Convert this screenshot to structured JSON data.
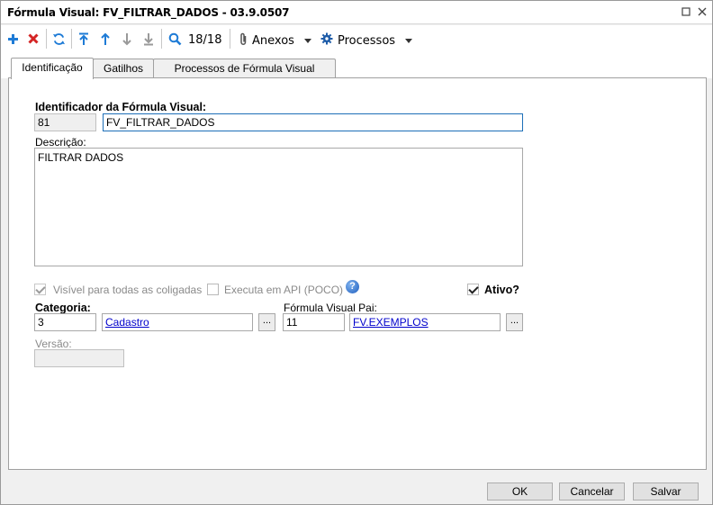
{
  "window": {
    "title": "Fórmula Visual: FV_FILTRAR_DADOS - 03.9.0507"
  },
  "toolbar": {
    "counter": "18/18",
    "anexos_label": "Anexos",
    "processos_label": "Processos"
  },
  "tabs": [
    {
      "label": "Identificação"
    },
    {
      "label": "Gatilhos"
    },
    {
      "label": "Processos de Fórmula Visual"
    }
  ],
  "form": {
    "identificador_label": "Identificador da Fórmula Visual:",
    "id_value": "81",
    "name_value": "FV_FILTRAR_DADOS",
    "descricao_label": "Descrição:",
    "descricao_value": "FILTRAR DADOS",
    "visivel_label": "Visível para todas as coligadas",
    "executa_label": "Executa em API (POCO)",
    "ativo_label": "Ativo?",
    "categoria_label": "Categoria:",
    "categoria_code": "3",
    "categoria_name": "Cadastro",
    "formula_pai_label": "Fórmula Visual Pai:",
    "formula_pai_code": "11",
    "formula_pai_name": "FV.EXEMPLOS",
    "versao_label": "Versão:",
    "versao_value": "",
    "ellipsis": "..."
  },
  "buttons": {
    "ok": "OK",
    "cancelar": "Cancelar",
    "salvar": "Salvar"
  },
  "colors": {
    "add": "#1e7bd6",
    "delete": "#d42424",
    "refresh": "#1e7bd6",
    "nav": "#1e7bd6",
    "nav_disabled": "#9a9a9a",
    "link": "#0000cc",
    "focus_border": "#1d6fb8"
  },
  "icons": {
    "add": "plus-icon",
    "delete": "x-icon",
    "refresh": "refresh-icon",
    "first": "arrow-first-icon",
    "prev": "arrow-up-icon",
    "next": "arrow-down-icon",
    "last": "arrow-last-icon",
    "search": "search-icon",
    "anexos": "paperclip-icon",
    "processos": "gear-icon",
    "help": "help-icon"
  }
}
